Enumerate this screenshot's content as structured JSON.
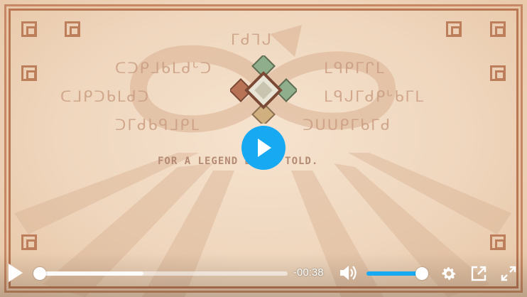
{
  "video": {
    "tagline": "FOR A LEGEND BEING TOLD.",
    "glyph_lines": [
      "ᒥᑯᒣᒍ",
      "ᑕᑐᑭᒧᑲᒪᑯᒡᑐ",
      "ᒪᑫᑭᒥᒋᒪ",
      "ᑕᒧᑭᑐᑲᒪᑯᑐ",
      "ᒪᑫᒍᒥᑯᑭᒡᑲᒥᒪ",
      "ᑐᒥᑯᑲᑫᒧᑭᒪ",
      "ᑐᑌᑌᑭᒥᑲᒥᑯ",
      "ᑐᒥᑲᒌᒥᑲᒥᑯᒌᒍ"
    ]
  },
  "controls": {
    "time_remaining": "-00:38",
    "progress": 0.0,
    "buffered": 0.42,
    "volume": 1.0,
    "accent_color": "#17a9f2"
  },
  "icons": {
    "big_play": "play-icon",
    "play": "play-icon",
    "volume": "volume-icon",
    "settings": "gear-icon",
    "popout": "popout-icon",
    "fullscreen": "fullscreen-icon"
  }
}
